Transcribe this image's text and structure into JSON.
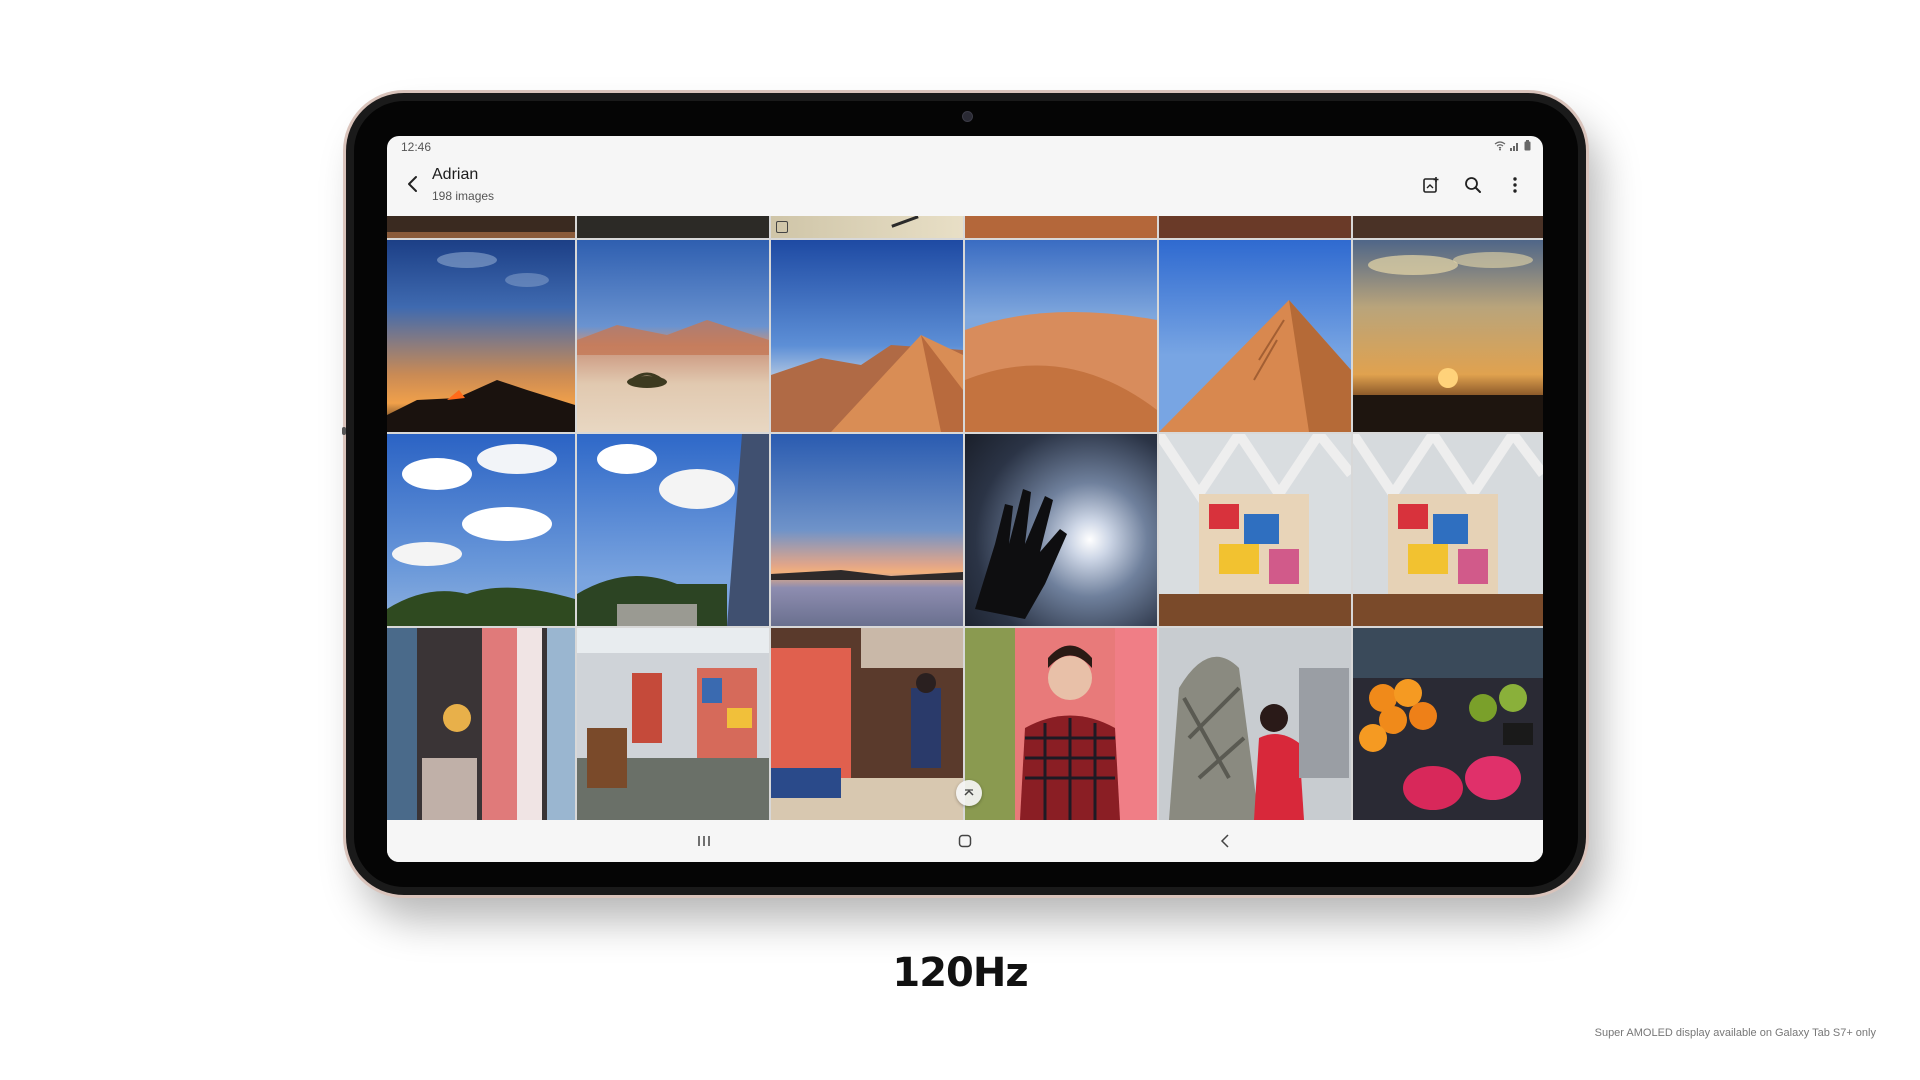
{
  "status_bar": {
    "time": "12:46",
    "icons": [
      "wifi-icon",
      "signal-icon",
      "battery-icon"
    ]
  },
  "app_bar": {
    "title": "Adrian",
    "subtitle": "198 images",
    "back_icon": "chevron-left-icon",
    "actions": [
      "create-story-icon",
      "search-icon",
      "more-options-icon"
    ]
  },
  "gallery": {
    "columns": 6,
    "rows": [
      {
        "kind": "partial",
        "items": [
          "desert",
          "desert",
          "lamp-sand",
          "desert",
          "desert",
          "desert"
        ]
      },
      {
        "kind": "full",
        "items": [
          "sunset-mountain",
          "desert-tree",
          "dune-sky",
          "dune-ridge",
          "dune-footprints",
          "sunset-clouds"
        ]
      },
      {
        "kind": "full",
        "items": [
          "clouds-sky",
          "park-clouds",
          "lake-sunset",
          "hand-sun",
          "art-studio",
          "art-studio"
        ]
      },
      {
        "kind": "full",
        "items": [
          "studio-interior",
          "studio-room",
          "studio-red",
          "portrait-man",
          "woman-sculpture",
          "fruit-market"
        ]
      }
    ]
  },
  "nav_bar": {
    "buttons": [
      "recents-icon",
      "home-icon",
      "back-icon"
    ]
  },
  "caption": "120Hz",
  "disclaimer": "Super AMOLED display available on Galaxy Tab S7+ only",
  "colors": {
    "tablet_frame": "#1a1a1a",
    "tablet_edge": "#d9c3bb",
    "screen_bg": "#f6f6f6",
    "caption": "#111111"
  }
}
